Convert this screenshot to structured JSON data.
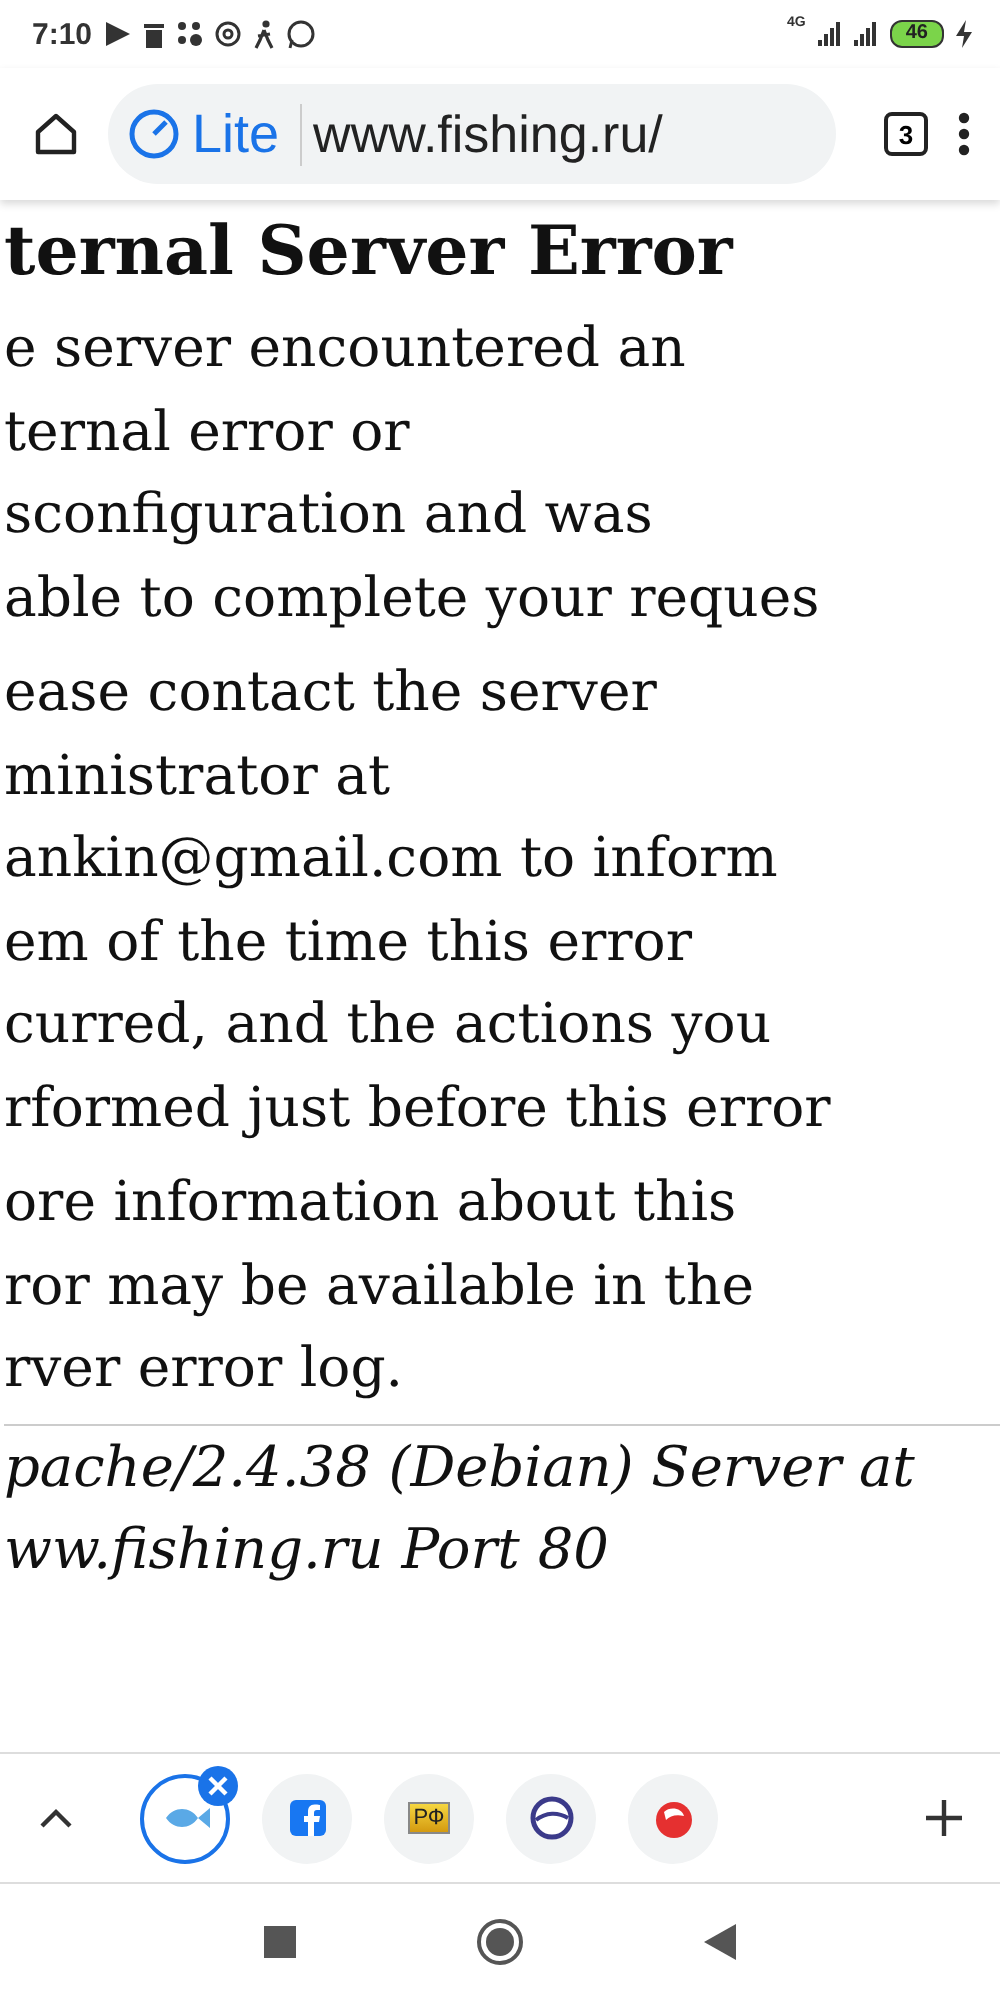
{
  "status_bar": {
    "time": "7:10",
    "network": "4G",
    "battery": "46"
  },
  "toolbar": {
    "mode": "Lite",
    "url": "www.fishing.ru/",
    "tab_count": "3"
  },
  "page": {
    "heading": "ternal Server Error",
    "paragraphs": [
      [
        "e server encountered an",
        "ternal error or",
        "sconfiguration and was",
        "able to complete your reques"
      ],
      [
        "ease contact the server",
        "ministrator at",
        "ankin@gmail.com to inform",
        "em of the time this error",
        "curred, and the actions you",
        "rformed just before this error"
      ],
      [
        "ore information about this",
        "ror may be available in the",
        "rver error log."
      ]
    ],
    "address": [
      "pache/2.4.38 (Debian) Server at",
      "ww.fishing.ru Port 80"
    ]
  },
  "shortcuts": [
    {
      "kind": "fish",
      "selected": true
    },
    {
      "kind": "facebook",
      "selected": false
    },
    {
      "kind": "text",
      "label": "РФ",
      "selected": false
    },
    {
      "kind": "oval",
      "selected": false
    },
    {
      "kind": "bobber",
      "selected": false
    }
  ]
}
